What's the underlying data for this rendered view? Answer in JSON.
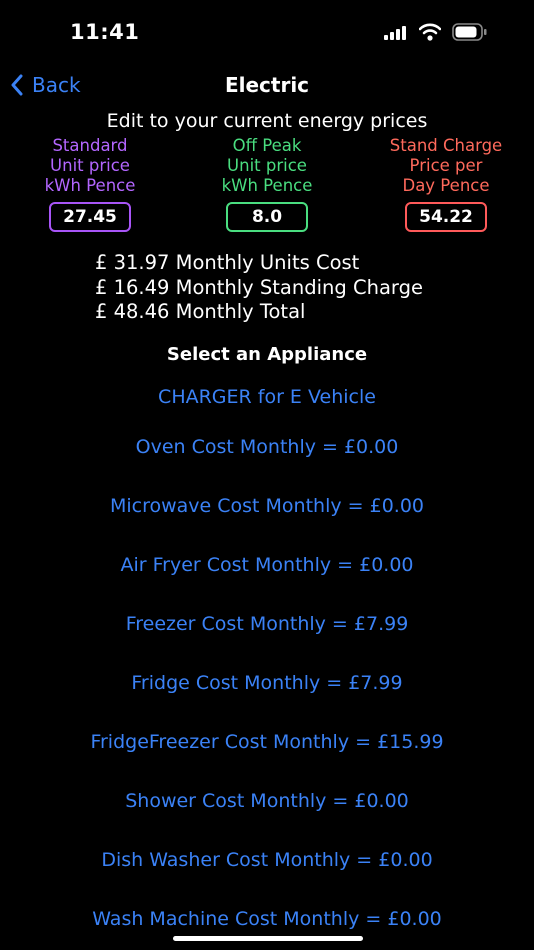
{
  "status": {
    "time": "11:41"
  },
  "nav": {
    "back_label": "Back",
    "title": "Electric"
  },
  "subtitle": "Edit to your current energy prices",
  "prices": {
    "standard": {
      "line1": "Standard",
      "line2": "Unit price",
      "line3": "kWh Pence",
      "value": "27.45"
    },
    "off_peak": {
      "line1": "Off Peak",
      "line2": "Unit price",
      "line3": "kWh Pence",
      "value": "8.0"
    },
    "stand_charge": {
      "line1": "Stand Charge",
      "line2": "Price per",
      "line3": "Day Pence",
      "value": "54.22"
    }
  },
  "summary": {
    "units_cost": "£ 31.97 Monthly Units Cost",
    "standing_charge": "£ 16.49 Monthly Standing Charge",
    "total": "£ 48.46 Monthly Total"
  },
  "appliances_title": "Select an Appliance",
  "appliances": [
    "CHARGER for E Vehicle",
    "Oven Cost Monthly = £0.00",
    "Microwave Cost Monthly = £0.00",
    "Air Fryer Cost Monthly = £0.00",
    "Freezer Cost Monthly = £7.99",
    "Fridge Cost Monthly = £7.99",
    "FridgeFreezer Cost Monthly = £15.99",
    "Shower Cost Monthly = £0.00",
    "Dish Washer Cost Monthly = £0.00",
    "Wash Machine Cost Monthly = £0.00"
  ],
  "colors": {
    "accent_blue": "#3b82f6",
    "standard_purple": "#a855f7",
    "offpeak_green": "#4ade80",
    "standcharge_red": "#ff5a5a"
  }
}
